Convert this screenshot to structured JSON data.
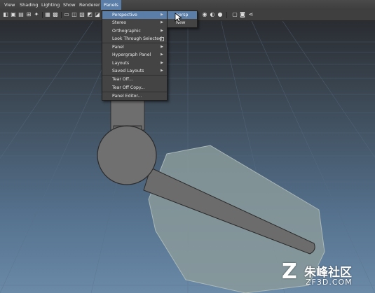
{
  "menubar": {
    "items": [
      "View",
      "Shading",
      "Lighting",
      "Show",
      "Renderer",
      "Panels"
    ]
  },
  "toolbar": {
    "icons": [
      "camera-select-icon",
      "camera-attr-icon",
      "bookmark-icon",
      "image-plane-icon",
      "grid-icon",
      "film-gate-icon",
      "resolution-gate-icon",
      "wireframe-icon",
      "smooth-shade-icon",
      "textured-icon",
      "lights-icon",
      "shadows-icon",
      "isolate-select-icon",
      "xray-icon",
      "hud-icon"
    ]
  },
  "panels_menu": {
    "items": [
      {
        "label": "Perspective",
        "submenu": true,
        "highlighted": true
      },
      {
        "label": "Stereo",
        "submenu": true
      },
      {
        "label": "Orthographic",
        "submenu": true
      },
      {
        "label": "Look Through Selected",
        "option_box": true
      },
      {
        "label": "Panel",
        "submenu": true,
        "separator": true
      },
      {
        "label": "Hypergraph Panel",
        "submenu": true
      },
      {
        "label": "Layouts",
        "submenu": true
      },
      {
        "label": "Saved Layouts",
        "submenu": true
      },
      {
        "label": "Tear Off...",
        "separator": true
      },
      {
        "label": "Tear Off Copy..."
      },
      {
        "label": "Panel Editor...",
        "separator": true
      }
    ]
  },
  "perspective_submenu": {
    "items": [
      {
        "label": "persp",
        "highlighted": true
      },
      {
        "label": "New"
      }
    ]
  },
  "watermark": {
    "logo_mark": "Z",
    "name": "朱峰社区",
    "url": "ZF3D.COM"
  },
  "colors": {
    "highlight": "#5a7ea8",
    "menu_bg": "#444444",
    "model_gray": "#6e6e6e",
    "proxy_shape": "#8a9a9a"
  }
}
